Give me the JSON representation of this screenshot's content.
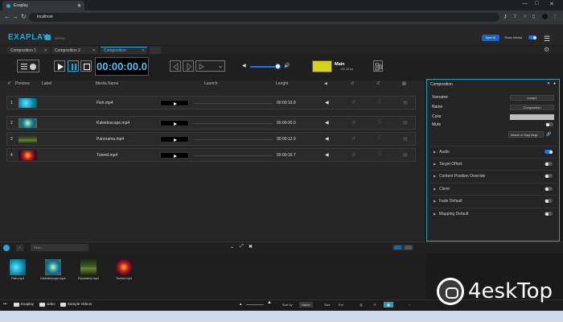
{
  "browser": {
    "tab_title": "Exaplay",
    "url": "localhost"
  },
  "app": {
    "logo": "EXAPLAY",
    "version": "v3.9.0.0",
    "sync_label": "Sync UI",
    "show_media_label": "Show Media",
    "show_media_on": true,
    "accent_color": "#29a6d9"
  },
  "comp_tabs": [
    {
      "label": "Composition 1"
    },
    {
      "label": "Composition 2"
    },
    {
      "label": "Composition"
    }
  ],
  "transport": {
    "timecode": "00:00:00.0",
    "volume_level": 0.9,
    "output_label": "Main",
    "output_fps": "109.26 fps",
    "output_color": "#d4d31c"
  },
  "table": {
    "headers": {
      "num": "#",
      "preview": "Preview",
      "label": "Label",
      "media": "Media Name",
      "launch": "Launch",
      "length": "Lenght"
    },
    "rows": [
      {
        "num": "1",
        "media": "Fish.mp4",
        "length": "00:00:19.8",
        "thumb": "fish"
      },
      {
        "num": "2",
        "media": "Kaleidoscope.mp4",
        "length": "00:00:20.0",
        "thumb": "kaleido"
      },
      {
        "num": "3",
        "media": "Panorama.mp4",
        "length": "00:00:12.9",
        "thumb": "pano"
      },
      {
        "num": "4",
        "media": "Tunnel.mp4",
        "length": "00:00:16.7",
        "thumb": "tunnel"
      }
    ]
  },
  "props": {
    "title": "Composition",
    "varname_label": "Varname",
    "varname_value": "comp1",
    "name_label": "Name",
    "name_value": "Composition",
    "color_label": "Color",
    "color_value": "#bdbdbd",
    "mute_label": "Mute",
    "search_drag": "Search or Drag Targe",
    "sections": [
      {
        "label": "Audio",
        "on": true
      },
      {
        "label": "Target Offset",
        "on": false
      },
      {
        "label": "Content Position Override",
        "on": false
      },
      {
        "label": "Client",
        "on": false
      },
      {
        "label": "Fade Default",
        "on": false
      },
      {
        "label": "Mapping Default",
        "on": false
      }
    ]
  },
  "media_browser": {
    "filter_placeholder": "Filter...",
    "items": [
      {
        "name": "Fish.mp4",
        "thumb": "fish"
      },
      {
        "name": "Kaleidoscope.mp4",
        "thumb": "kaleido"
      },
      {
        "name": "Panorama.mp4",
        "thumb": "pano"
      },
      {
        "name": "Tunnel.mp4",
        "thumb": "tunnel"
      }
    ]
  },
  "bottom": {
    "breadcrumbs": [
      "Exaplay",
      "video",
      "Sample Videos"
    ],
    "sort_label": "Sort by",
    "sort_options": [
      "Name",
      "Size",
      "Ext"
    ]
  },
  "watermark": "4eskTop"
}
